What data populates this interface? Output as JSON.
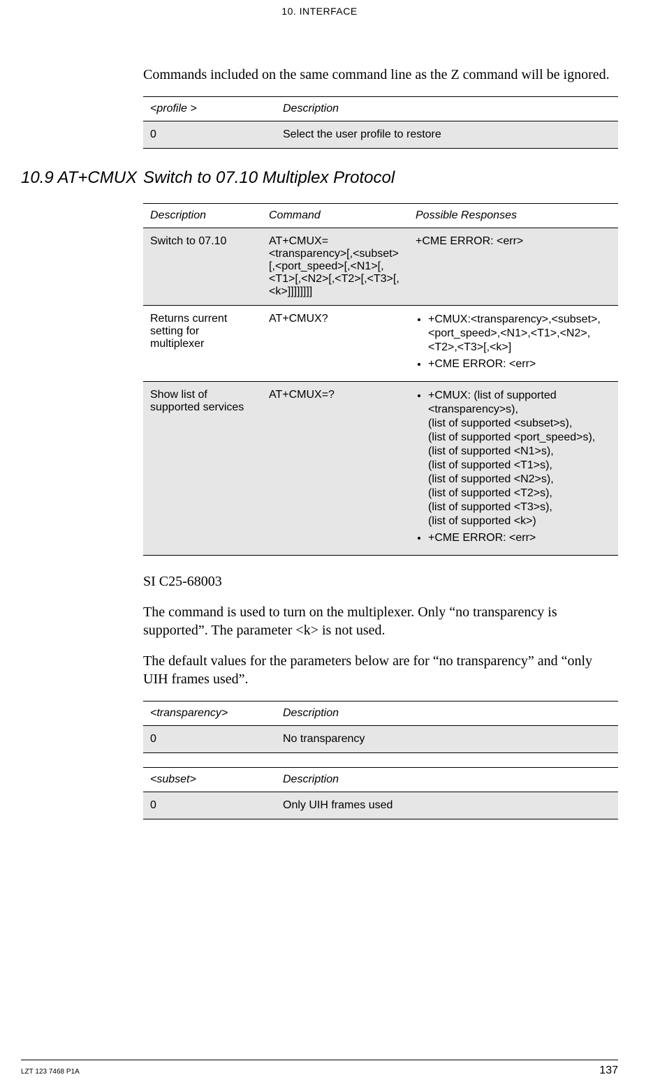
{
  "header": {
    "chapter": "10. INTERFACE"
  },
  "intro_para": "Commands included on the same command line as the Z command will be ignored.",
  "profile_table": {
    "headers": {
      "c1": "<profile >",
      "c2": "Description"
    },
    "row": {
      "c1": "0",
      "c2": "Select the user profile to restore"
    }
  },
  "section": {
    "num": "10.9 AT+CMUX",
    "title": "Switch to 07.10 Multiplex Protocol"
  },
  "cmd_table": {
    "headers": {
      "c1": "Description",
      "c2": "Command",
      "c3": "Possible Responses"
    },
    "rows": [
      {
        "desc": "Switch to 07.10",
        "cmd": "AT+CMUX=<transparency>[,<subset>[,<port_speed>[,<N1>[,<T1>[,<N2>[,<T2>[,<T3>[,<k>]]]]]]]]",
        "resp_plain": "+CME ERROR: <err>"
      },
      {
        "desc": "Returns current setting for multiplexer",
        "cmd": "AT+CMUX?",
        "resp_items": [
          "+CMUX:<transparency>,<subset>,<port_speed>,<N1>,<T1>,<N2>,<T2>,<T3>[,<k>]",
          "+CME ERROR: <err>"
        ]
      },
      {
        "desc": "Show list of supported services",
        "cmd": "AT+CMUX=?",
        "resp_items": [
          "+CMUX: (list of supported <transparency>s),\n(list of supported <subset>s),\n(list of supported <port_speed>s),\n(list of supported <N1>s),\n(list of supported <T1>s),\n(list of supported <N2>s),\n(list of supported <T2>s),\n(list of supported <T3>s),\n(list of supported <k>)",
          "+CME ERROR: <err>"
        ]
      }
    ]
  },
  "ref_line": "SI C25-68003",
  "para2": "The command is used to turn on the multiplexer. Only “no transparency is supported”. The parameter <k> is not used.",
  "para3": "The default values for the parameters below are for “no transparency” and “only UIH frames used”.",
  "transparency_table": {
    "headers": {
      "c1": "<transparency>",
      "c2": "Description"
    },
    "row": {
      "c1": "0",
      "c2": "No transparency"
    }
  },
  "subset_table": {
    "headers": {
      "c1": "<subset>",
      "c2": "Description"
    },
    "row": {
      "c1": "0",
      "c2": "Only UIH frames used"
    }
  },
  "footer": {
    "docid": "LZT 123 7468 P1A",
    "page": "137"
  }
}
